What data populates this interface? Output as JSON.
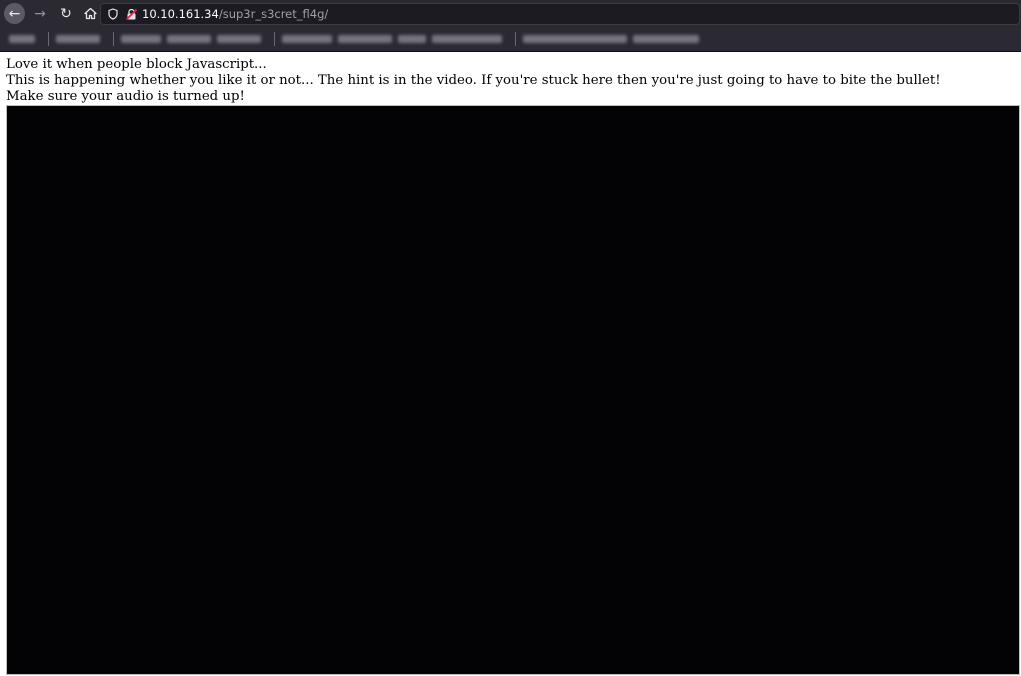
{
  "browser": {
    "url_host": "10.10.161.34",
    "url_path": "/sup3r_s3cret_fl4g/",
    "icons": {
      "back": "arrow-left-icon",
      "forward": "arrow-right-icon",
      "reload": "reload-icon",
      "home": "home-icon",
      "shield": "shield-icon",
      "insecure": "insecure-lock-icon"
    }
  },
  "page": {
    "line1": "Love it when people block Javascript...",
    "line2": "This is happening whether you like it or not... The hint is in the video. If you're stuck here then you're just going to have to bite the bullet!",
    "line3": "Make sure your audio is turned up!"
  },
  "colors": {
    "chrome_bg": "#2b2a33",
    "urlbar_bg": "#1c1b22",
    "video_bg": "#030204"
  }
}
